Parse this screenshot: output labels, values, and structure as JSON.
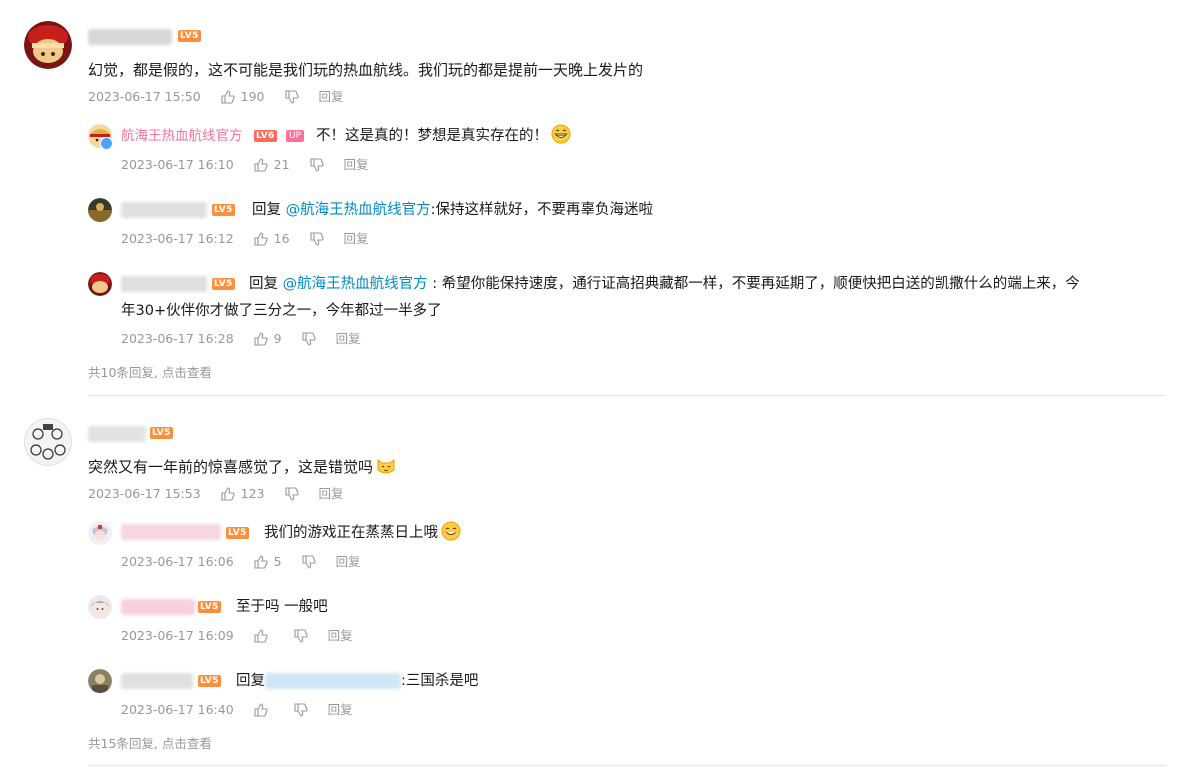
{
  "threads": [
    {
      "comment": {
        "level": "LV5",
        "text": "幻觉，都是假的，这不可能是我们玩的热血航线。我们玩的都是提前一天晚上发片的",
        "time": "2023-06-17 15:50",
        "likes": "190",
        "reply_label": "回复"
      },
      "replies": [
        {
          "username": "航海王热血航线官方",
          "level": "LV6",
          "badge": "UP",
          "text": "不！这是真的！梦想是真实存在的！",
          "emoji": "grinning-face",
          "time": "2023-06-17 16:10",
          "likes": "21",
          "reply_label": "回复"
        },
        {
          "level": "LV5",
          "prefix": "回复 ",
          "mention": "@航海王热血航线官方",
          "text": ":保持这样就好，不要再辜负海迷啦",
          "time": "2023-06-17 16:12",
          "likes": "16",
          "reply_label": "回复"
        },
        {
          "level": "LV5",
          "prefix": "回复 ",
          "mention": "@航海王热血航线官方",
          "text_line1": " : 希望你能保持速度，通行证高招典藏都一样，不要再延期了，顺便快把白送的凯撒什么的端上来，今",
          "text_line2": "年30+伙伴你才做了三分之一，今年都过一半多了",
          "time": "2023-06-17 16:28",
          "likes": "9",
          "reply_label": "回复"
        }
      ],
      "view_more": "共10条回复, 点击查看"
    },
    {
      "comment": {
        "level": "LV5",
        "text": "突然又有一年前的惊喜感觉了，这是错觉吗",
        "emoji": "cat-face",
        "time": "2023-06-17 15:53",
        "likes": "123",
        "reply_label": "回复"
      },
      "replies": [
        {
          "level": "LV5",
          "text": "我们的游戏正在蒸蒸日上哦",
          "emoji": "smiling-face",
          "time": "2023-06-17 16:06",
          "likes": "5",
          "reply_label": "回复"
        },
        {
          "level": "LV5",
          "text": "至于吗 一般吧",
          "time": "2023-06-17 16:09",
          "likes": "",
          "reply_label": "回复"
        },
        {
          "level": "LV5",
          "prefix": "回复",
          "text": ":三国杀是吧",
          "time": "2023-06-17 16:40",
          "likes": "",
          "reply_label": "回复"
        }
      ],
      "view_more": "共15条回复, 点击查看"
    }
  ],
  "colors": {
    "accent_link": "#008ac5",
    "official_pink": "#fb7299",
    "meta_gray": "#9499a0",
    "level_orange": "#ff8f3d"
  }
}
